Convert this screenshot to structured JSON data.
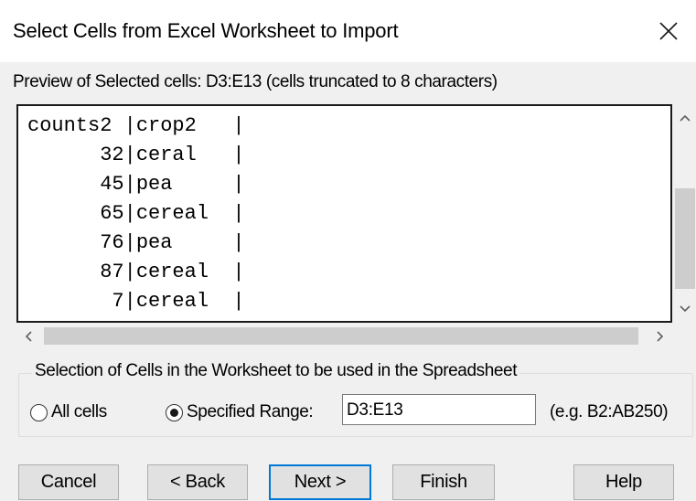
{
  "window": {
    "title": "Select Cells from Excel Worksheet to Import"
  },
  "preview": {
    "label": "Preview of Selected cells: D3:E13 (cells truncated to 8 characters)",
    "lines": [
      "counts2 |crop2   |",
      "      32|ceral   |",
      "      45|pea     |",
      "      65|cereal  |",
      "      76|pea     |",
      "      87|cereal  |",
      "       7|cereal  |"
    ]
  },
  "selection": {
    "legend": "Selection of Cells in the Worksheet to be used in the Spreadsheet",
    "all_cells_label": "All cells",
    "all_cells_selected": false,
    "specified_range_label": "Specified Range:",
    "specified_range_selected": true,
    "range_value": "D3:E13",
    "range_hint": "(e.g. B2:AB250)"
  },
  "buttons": {
    "cancel": "Cancel",
    "back": "< Back",
    "next": "Next >",
    "finish": "Finish",
    "help": "Help"
  },
  "icons": {
    "close": "close-icon",
    "scroll_up": "chevron-up-icon",
    "scroll_down": "chevron-down-icon",
    "scroll_left": "chevron-left-icon",
    "scroll_right": "chevron-right-icon"
  },
  "colors": {
    "default_button_border": "#0078d7",
    "dialog_background": "#f0f0f0",
    "scrollbar_thumb": "#cdcdcd"
  }
}
